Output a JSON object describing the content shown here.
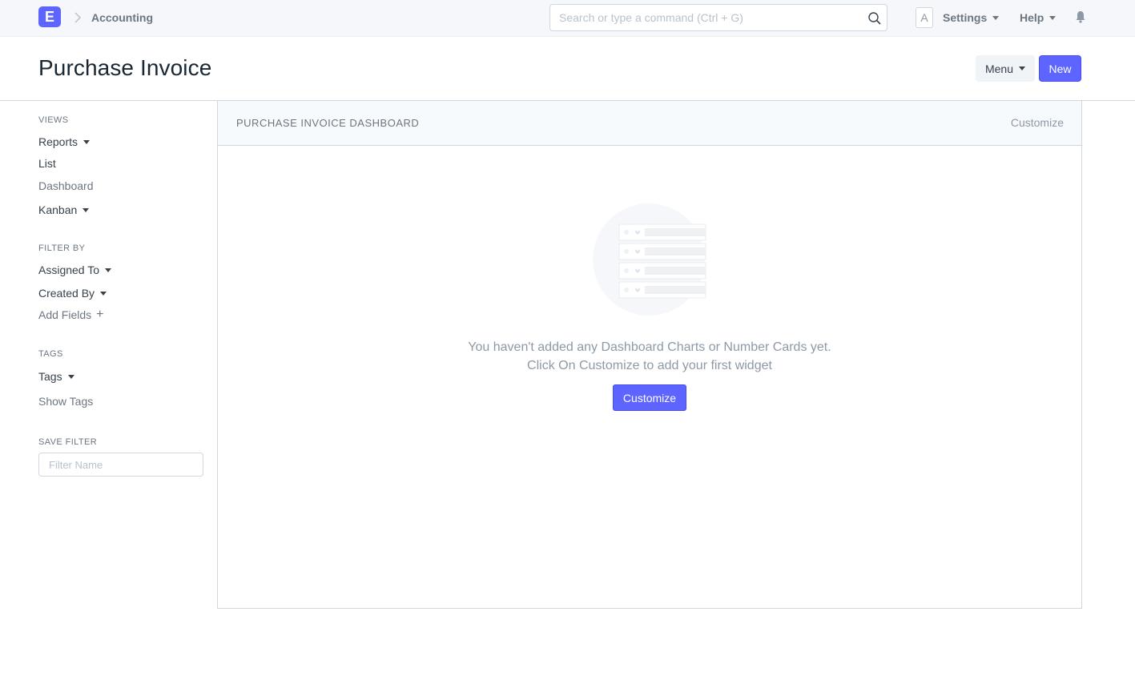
{
  "navbar": {
    "logo_letter": "E",
    "breadcrumb": "Accounting",
    "search_placeholder": "Search or type a command (Ctrl + G)",
    "avatar_letter": "A",
    "settings_label": "Settings",
    "help_label": "Help"
  },
  "page": {
    "title": "Purchase Invoice",
    "menu_label": "Menu",
    "new_label": "New"
  },
  "sidebar": {
    "views_heading": "Views",
    "views": [
      "Reports",
      "List",
      "Dashboard",
      "Kanban"
    ],
    "filter_heading": "Filter By",
    "filters": [
      "Assigned To",
      "Created By"
    ],
    "add_fields": "Add Fields",
    "tags_heading": "Tags",
    "tags_label": "Tags",
    "show_tags": "Show Tags",
    "save_filter_heading": "Save Filter",
    "filter_name_placeholder": "Filter Name"
  },
  "dashboard": {
    "title": "Purchase Invoice Dashboard",
    "customize_link": "Customize",
    "empty_line1": "You haven't added any Dashboard Charts or Number Cards yet.",
    "empty_line2": "Click On Customize to add your first widget",
    "customize_button": "Customize"
  },
  "colors": {
    "primary": "#5e64ff",
    "navbar_bg": "#f5f7fa",
    "border": "#d1d8dd",
    "muted_text": "#8d99a6"
  }
}
